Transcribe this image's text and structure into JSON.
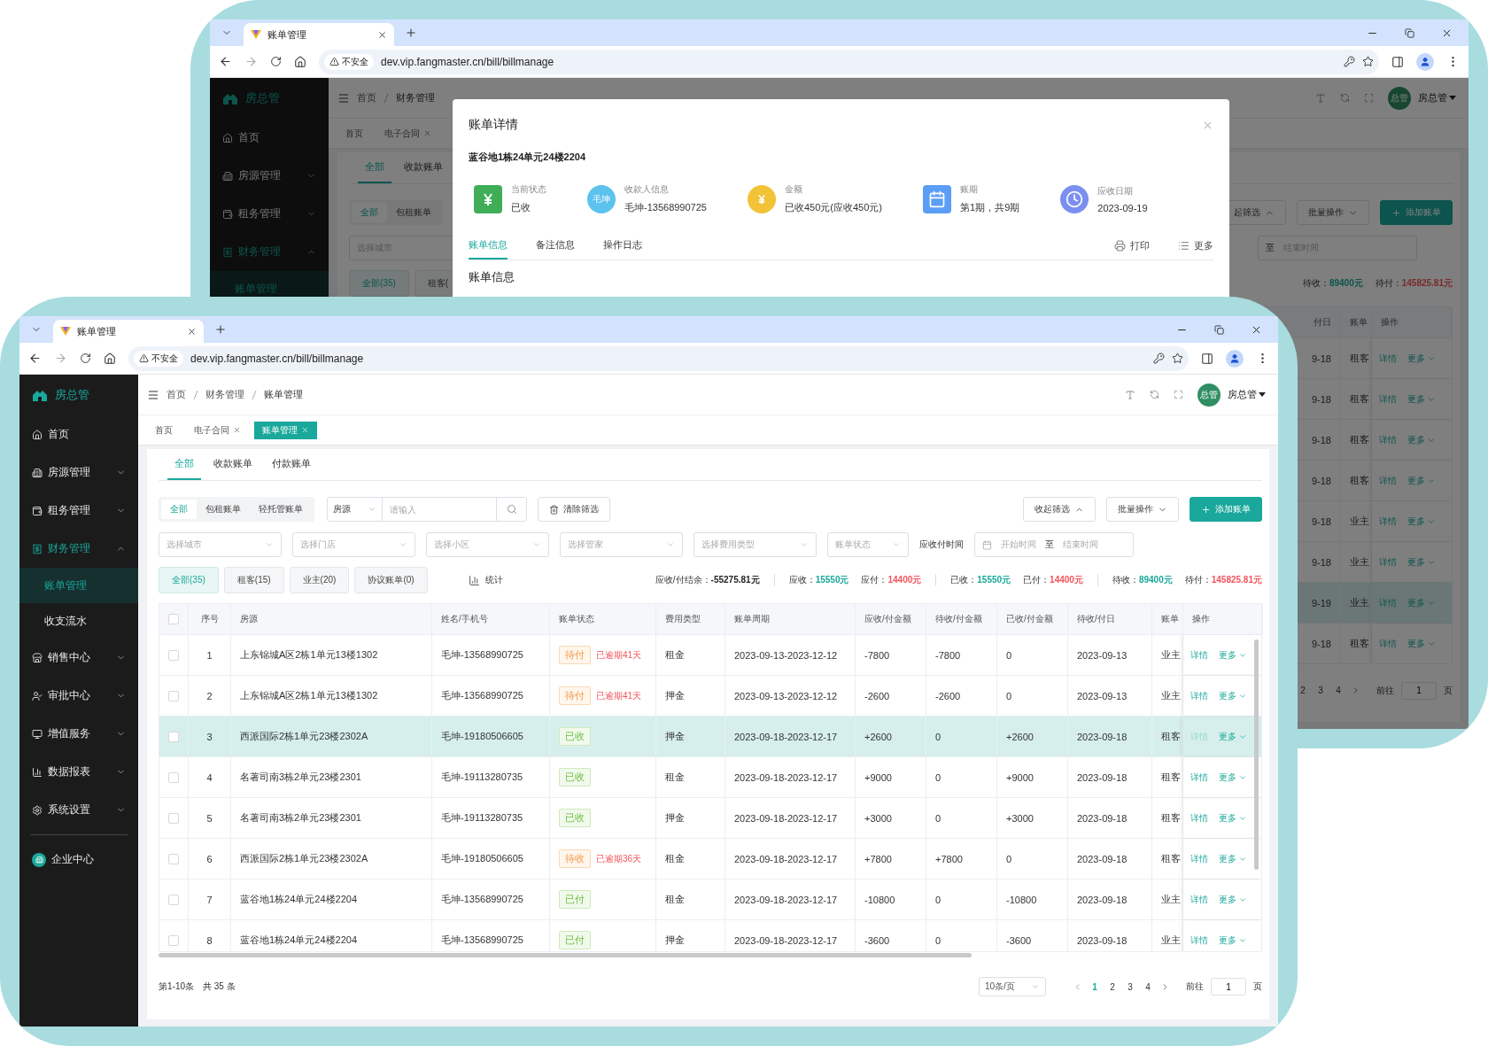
{
  "back_window": {
    "tab_title": "账单管理",
    "security": "不安全",
    "url": "dev.vip.fangmaster.cn/bill/billmanage",
    "sidebar": {
      "brand": "房总管",
      "items": [
        {
          "label": "首页",
          "kind": "link"
        },
        {
          "label": "房源管理",
          "kind": "group",
          "expanded": false
        },
        {
          "label": "租务管理",
          "kind": "group",
          "expanded": false
        },
        {
          "label": "财务管理",
          "kind": "group",
          "expanded": true,
          "children": [
            {
              "label": "账单管理",
              "selected": true
            }
          ]
        }
      ]
    },
    "breadcrumb": [
      "首页",
      "财务管理"
    ],
    "user": {
      "avatar": "总管",
      "name": "房总管"
    },
    "tags": [
      {
        "label": "首页",
        "closable": false,
        "selected": false
      },
      {
        "label": "电子合同",
        "closable": true,
        "selected": false
      }
    ],
    "subtabs": [
      {
        "label": "全部",
        "selected": true
      },
      {
        "label": "收款账单",
        "selected": false
      }
    ],
    "segments": [
      {
        "label": "全部",
        "selected": true
      },
      {
        "label": "包租账单",
        "selected": false
      }
    ],
    "city_select": "选择城市",
    "actions": {
      "collapse": "起筛选",
      "batch": "批量操作",
      "add": "添加账单"
    },
    "date_range": {
      "to": "至",
      "end": "结束时间"
    },
    "count_tabs": [
      {
        "label": "全部(35)",
        "selected": true
      },
      {
        "label": "租客(",
        "selected": false
      }
    ],
    "totals": [
      {
        "label": "待收：",
        "value": "89400元",
        "color": "#0c544d",
        "separated": false
      },
      {
        "label": "待付：",
        "value": "145825.81元",
        "color": "#792a2d",
        "separated": false
      }
    ],
    "table": {
      "columns": [
        "付日",
        "账单",
        "操作"
      ],
      "rows": [
        {
          "date": "9-18",
          "type": "租客",
          "actions": [
            "详情",
            "更多"
          ],
          "highlighted": false
        },
        {
          "date": "9-18",
          "type": "租客",
          "actions": [
            "详情",
            "更多"
          ],
          "highlighted": false
        },
        {
          "date": "9-18",
          "type": "租客",
          "actions": [
            "详情",
            "更多"
          ],
          "highlighted": false
        },
        {
          "date": "9-18",
          "type": "租客",
          "actions": [
            "详情",
            "更多"
          ],
          "highlighted": false
        },
        {
          "date": "9-18",
          "type": "业主",
          "actions": [
            "详情",
            "更多"
          ],
          "highlighted": false
        },
        {
          "date": "9-18",
          "type": "业主",
          "actions": [
            "详情",
            "更多"
          ],
          "highlighted": false
        },
        {
          "date": "9-19",
          "type": "业主",
          "actions": [
            "详情",
            "更多"
          ],
          "highlighted": true
        },
        {
          "date": "9-18",
          "type": "租客",
          "actions": [
            "详情",
            "更多"
          ],
          "highlighted": false
        }
      ]
    },
    "pagination": {
      "pages": [
        {
          "label": "2",
          "selected": false
        },
        {
          "label": "3",
          "selected": false
        },
        {
          "label": "4",
          "selected": false
        }
      ],
      "goto": "前往",
      "page": "1",
      "unit": "页"
    },
    "modal": {
      "title": "账单详情",
      "address": "蓝谷地1栋24单元24楼2204",
      "info": [
        {
          "label": "当前状态",
          "value": "已收"
        },
        {
          "label": "收款人信息",
          "value": "毛坤-13568990725",
          "avatar": "毛坤"
        },
        {
          "label": "金额",
          "value": "已收450元(应收450元)"
        },
        {
          "label": "账期",
          "value": "第1期，共9期"
        },
        {
          "label": "应收日期",
          "value": "2023-09-19"
        }
      ],
      "tabs": [
        {
          "label": "账单信息",
          "selected": true
        },
        {
          "label": "备注信息",
          "selected": false
        },
        {
          "label": "操作日志",
          "selected": false
        }
      ],
      "print": "打印",
      "more": "更多",
      "section_title": "账单信息"
    }
  },
  "front_window": {
    "tab_title": "账单管理",
    "security": "不安全",
    "url": "dev.vip.fangmaster.cn/bill/billmanage",
    "sidebar": {
      "brand": "房总管",
      "items": [
        {
          "label": "首页",
          "kind": "link"
        },
        {
          "label": "房源管理",
          "kind": "group",
          "expanded": false
        },
        {
          "label": "租务管理",
          "kind": "group",
          "expanded": false
        },
        {
          "label": "财务管理",
          "kind": "group",
          "expanded": true,
          "children": [
            {
              "label": "账单管理",
              "selected": true
            },
            {
              "label": "收支流水",
              "selected": false
            }
          ]
        },
        {
          "label": "销售中心",
          "kind": "group",
          "expanded": false
        },
        {
          "label": "审批中心",
          "kind": "group",
          "expanded": false
        },
        {
          "label": "增值服务",
          "kind": "group",
          "expanded": false
        },
        {
          "label": "数据报表",
          "kind": "group",
          "expanded": false
        },
        {
          "label": "系统设置",
          "kind": "group",
          "expanded": false
        },
        {
          "label": "企业中心",
          "kind": "footer"
        }
      ]
    },
    "breadcrumb": [
      "首页",
      "财务管理",
      "账单管理"
    ],
    "user": {
      "avatar": "总管",
      "name": "房总管"
    },
    "tags": [
      {
        "label": "首页",
        "closable": false,
        "selected": false
      },
      {
        "label": "电子合同",
        "closable": true,
        "selected": false
      },
      {
        "label": "账单管理",
        "closable": true,
        "selected": true
      }
    ],
    "subtabs": [
      {
        "label": "全部",
        "selected": true
      },
      {
        "label": "收款账单",
        "selected": false
      },
      {
        "label": "付款账单",
        "selected": false
      }
    ],
    "segments": [
      {
        "label": "全部",
        "selected": true
      },
      {
        "label": "包租账单",
        "selected": false
      },
      {
        "label": "轻托管账单",
        "selected": false
      }
    ],
    "search": {
      "field": "房源",
      "placeholder": "请输入"
    },
    "clear": "清除筛选",
    "actions": {
      "collapse": "收起筛选",
      "batch": "批量操作",
      "add": "添加账单"
    },
    "selects": [
      "选择城市",
      "选择门店",
      "选择小区",
      "选择管家",
      "选择费用类型",
      "账单状态"
    ],
    "date_label": "应收付时间",
    "date_range": {
      "start": "开始时间",
      "to": "至",
      "end": "结束时间"
    },
    "count_tabs": [
      {
        "label": "全部(35)",
        "selected": true
      },
      {
        "label": "租客(15)",
        "selected": false
      },
      {
        "label": "业主(20)",
        "selected": false
      },
      {
        "label": "协议账单(0)",
        "selected": false
      }
    ],
    "stats": "统计",
    "totals": [
      {
        "label": "应收/付结余：",
        "value": "-55275.81元",
        "color": "#222222",
        "separated": false
      },
      {
        "label": "应收：",
        "value": "15550元",
        "color": "#19a89b",
        "separated": true
      },
      {
        "label": "应付：",
        "value": "14400元",
        "color": "#f2545b",
        "separated": false
      },
      {
        "label": "已收：",
        "value": "15550元",
        "color": "#19a89b",
        "separated": true
      },
      {
        "label": "已付：",
        "value": "14400元",
        "color": "#f2545b",
        "separated": false
      },
      {
        "label": "待收：",
        "value": "89400元",
        "color": "#19a89b",
        "separated": true
      },
      {
        "label": "待付：",
        "value": "145825.81元",
        "color": "#f2545b",
        "separated": false
      }
    ],
    "table": {
      "header_checked": false,
      "columns": [
        "序号",
        "房源",
        "姓名/手机号",
        "账单状态",
        "费用类型",
        "账单周期",
        "应收/付金额",
        "待收/付金额",
        "已收/付金额",
        "待收/付日",
        "账单",
        "操作"
      ],
      "rows": [
        {
          "checked": false,
          "highlighted": false,
          "no": "1",
          "property": "上东锦城A区2栋1单元13楼1302",
          "tenant": "毛坤-13568990725",
          "status": {
            "label": "待付",
            "kind": "warning"
          },
          "overdue": "已逾期41天",
          "fee": "租金",
          "period": "2023-09-13-2023-12-12",
          "due": "-7800",
          "pending": "-7800",
          "paid": "0",
          "date": "2023-09-13",
          "type": "业主",
          "actions": [
            "详情",
            "更多"
          ]
        },
        {
          "checked": false,
          "highlighted": false,
          "no": "2",
          "property": "上东锦城A区2栋1单元13楼1302",
          "tenant": "毛坤-13568990725",
          "status": {
            "label": "待付",
            "kind": "warning"
          },
          "overdue": "已逾期41天",
          "fee": "押金",
          "period": "2023-09-13-2023-12-12",
          "due": "-2600",
          "pending": "-2600",
          "paid": "0",
          "date": "2023-09-13",
          "type": "业主",
          "actions": [
            "详情",
            "更多"
          ]
        },
        {
          "checked": false,
          "highlighted": true,
          "no": "3",
          "property": "西派国际2栋1单元23楼2302A",
          "tenant": "毛坤-19180506605",
          "status": {
            "label": "已收",
            "kind": "success"
          },
          "fee": "押金",
          "period": "2023-09-18-2023-12-17",
          "due": "+2600",
          "pending": "0",
          "paid": "+2600",
          "date": "2023-09-18",
          "type": "租客",
          "actions": [
            "详情",
            "更多"
          ]
        },
        {
          "checked": false,
          "highlighted": false,
          "no": "4",
          "property": "名著司南3栋2单元23楼2301",
          "tenant": "毛坤-19113280735",
          "status": {
            "label": "已收",
            "kind": "success"
          },
          "fee": "租金",
          "period": "2023-09-18-2023-12-17",
          "due": "+9000",
          "pending": "0",
          "paid": "+9000",
          "date": "2023-09-18",
          "type": "租客",
          "actions": [
            "详情",
            "更多"
          ]
        },
        {
          "checked": false,
          "highlighted": false,
          "no": "5",
          "property": "名著司南3栋2单元23楼2301",
          "tenant": "毛坤-19113280735",
          "status": {
            "label": "已收",
            "kind": "success"
          },
          "fee": "押金",
          "period": "2023-09-18-2023-12-17",
          "due": "+3000",
          "pending": "0",
          "paid": "+3000",
          "date": "2023-09-18",
          "type": "租客",
          "actions": [
            "详情",
            "更多"
          ]
        },
        {
          "checked": false,
          "highlighted": false,
          "no": "6",
          "property": "西派国际2栋1单元23楼2302A",
          "tenant": "毛坤-19180506605",
          "status": {
            "label": "待收",
            "kind": "warning"
          },
          "overdue": "已逾期36天",
          "fee": "租金",
          "period": "2023-09-18-2023-12-17",
          "due": "+7800",
          "pending": "+7800",
          "paid": "0",
          "date": "2023-09-18",
          "type": "租客",
          "actions": [
            "详情",
            "更多"
          ]
        },
        {
          "checked": false,
          "highlighted": false,
          "no": "7",
          "property": "蓝谷地1栋24单元24楼2204",
          "tenant": "毛坤-13568990725",
          "status": {
            "label": "已付",
            "kind": "success"
          },
          "fee": "租金",
          "period": "2023-09-18-2023-12-17",
          "due": "-10800",
          "pending": "0",
          "paid": "-10800",
          "date": "2023-09-18",
          "type": "业主",
          "actions": [
            "详情",
            "更多"
          ]
        },
        {
          "checked": false,
          "highlighted": false,
          "no": "8",
          "property": "蓝谷地1栋24单元24楼2204",
          "tenant": "毛坤-13568990725",
          "status": {
            "label": "已付",
            "kind": "success"
          },
          "fee": "押金",
          "period": "2023-09-18-2023-12-17",
          "due": "-3600",
          "pending": "0",
          "paid": "-3600",
          "date": "2023-09-18",
          "type": "业主",
          "actions": [
            "详情",
            "更多"
          ]
        }
      ]
    },
    "footer": {
      "range": "第1-10条",
      "total": "共 35 条",
      "page_size": "10条/页"
    },
    "pagination": {
      "pages": [
        {
          "label": "1",
          "selected": true
        },
        {
          "label": "2",
          "selected": false
        },
        {
          "label": "3",
          "selected": false
        },
        {
          "label": "4",
          "selected": false
        }
      ],
      "goto": "前往",
      "page": "1",
      "unit": "页"
    }
  }
}
